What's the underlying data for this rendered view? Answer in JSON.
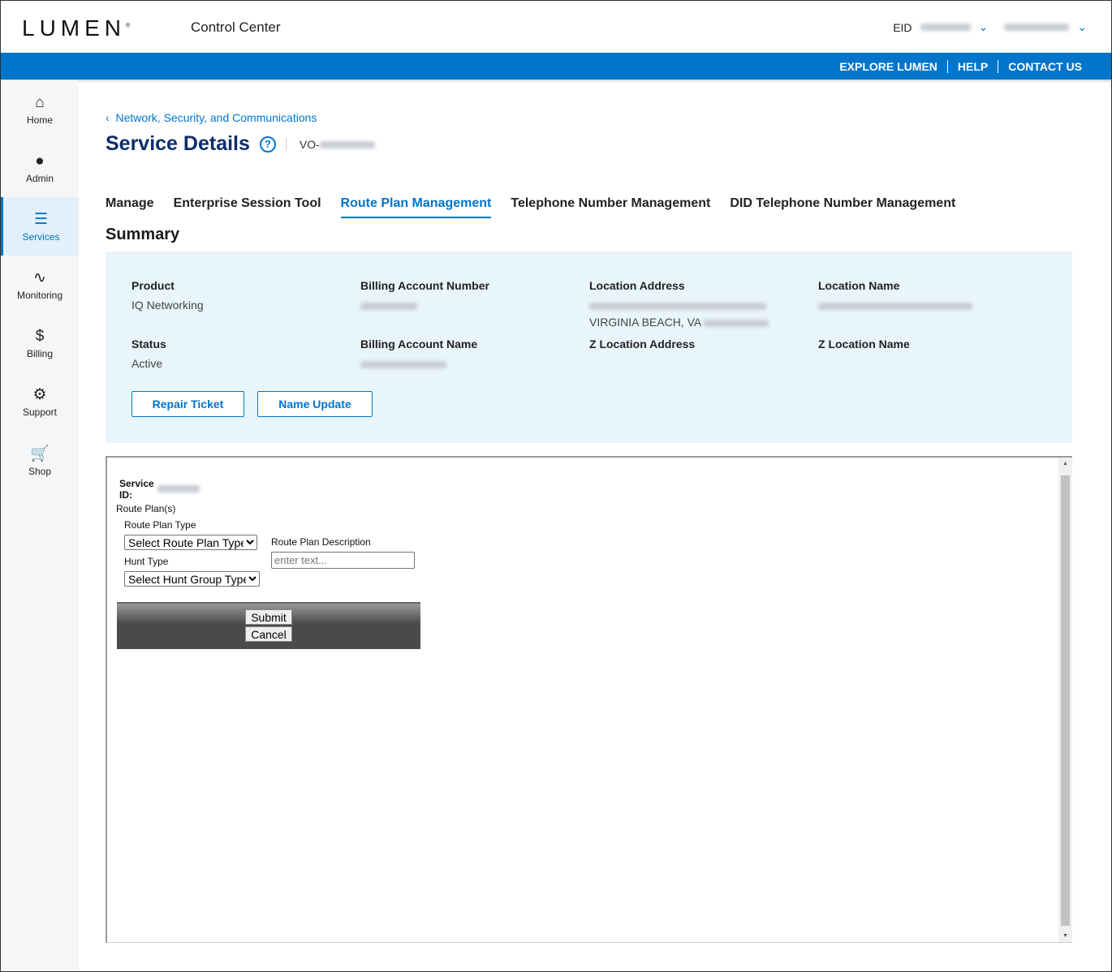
{
  "header": {
    "logo": "LUMEN",
    "app_title": "Control Center",
    "eid_label": "EID",
    "links": [
      "EXPLORE LUMEN",
      "HELP",
      "CONTACT US"
    ]
  },
  "sidebar": {
    "items": [
      {
        "label": "Home",
        "icon": "home-icon",
        "glyph": "⌂"
      },
      {
        "label": "Admin",
        "icon": "user-icon",
        "glyph": "●"
      },
      {
        "label": "Services",
        "icon": "list-icon",
        "glyph": "☰"
      },
      {
        "label": "Monitoring",
        "icon": "pulse-icon",
        "glyph": "∿"
      },
      {
        "label": "Billing",
        "icon": "invoice-icon",
        "glyph": "$"
      },
      {
        "label": "Support",
        "icon": "support-icon",
        "glyph": "⚙"
      },
      {
        "label": "Shop",
        "icon": "cart-icon",
        "glyph": "🛒"
      }
    ],
    "active": "Services"
  },
  "page": {
    "breadcrumb": "Network, Security, and Communications",
    "title": "Service Details",
    "vo_prefix": "VO-",
    "tabs": [
      "Manage",
      "Enterprise Session Tool",
      "Route Plan Management",
      "Telephone Number Management",
      "DID Telephone Number Management"
    ],
    "active_tab": "Route Plan Management",
    "summary_title": "Summary",
    "summary": {
      "product_label": "Product",
      "product": "IQ Networking",
      "status_label": "Status",
      "status": "Active",
      "ban_label": "Billing Account Number",
      "ban_name_label": "Billing Account Name",
      "loc_addr_label": "Location Address",
      "loc_addr_line2": "VIRGINIA BEACH, VA",
      "loc_name_label": "Location Name",
      "z_addr_label": "Z Location Address",
      "z_name_label": "Z Location Name"
    },
    "buttons": {
      "repair": "Repair Ticket",
      "name_update": "Name Update"
    }
  },
  "form": {
    "service_id_label": "Service ID:",
    "route_plans": "Route Plan(s)",
    "route_plan_type_label": "Route Plan Type",
    "route_plan_type": "Select Route Plan Type",
    "description_label": "Route Plan Description",
    "description_placeholder": "enter text...",
    "hunt_type_label": "Hunt Type",
    "hunt_type": "Select Hunt Group Type",
    "submit": "Submit",
    "cancel": "Cancel"
  },
  "colors": {
    "brand": "#0075c9",
    "title": "#0c2d6b",
    "card": "#e8f5fb"
  }
}
